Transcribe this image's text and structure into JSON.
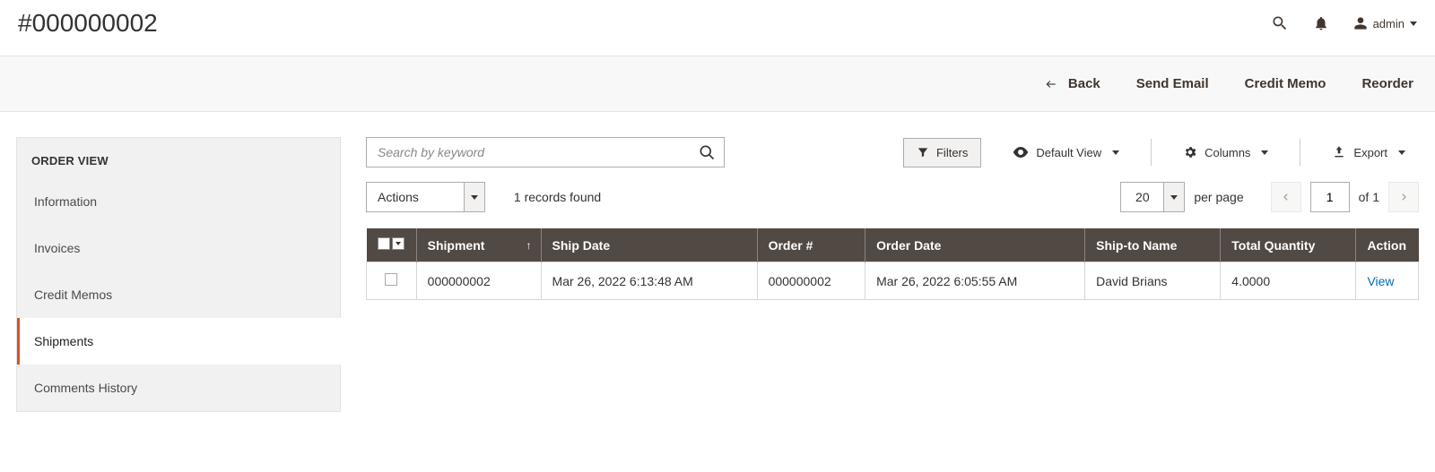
{
  "header": {
    "title": "#000000002",
    "user_label": "admin"
  },
  "action_bar": {
    "back": "Back",
    "send_email": "Send Email",
    "credit_memo": "Credit Memo",
    "reorder": "Reorder"
  },
  "sidebar": {
    "title": "ORDER VIEW",
    "items": [
      {
        "label": "Information",
        "active": false
      },
      {
        "label": "Invoices",
        "active": false
      },
      {
        "label": "Credit Memos",
        "active": false
      },
      {
        "label": "Shipments",
        "active": true
      },
      {
        "label": "Comments History",
        "active": false
      }
    ]
  },
  "toolbar": {
    "search_placeholder": "Search by keyword",
    "filters": "Filters",
    "default_view": "Default View",
    "columns": "Columns",
    "export": "Export",
    "actions_label": "Actions",
    "records_found": "1 records found",
    "page_size": "20",
    "per_page_label": "per page",
    "current_page": "1",
    "total_pages_prefix": "of",
    "total_pages": "1"
  },
  "table": {
    "headers": {
      "shipment": "Shipment",
      "ship_date": "Ship Date",
      "order": "Order #",
      "order_date": "Order Date",
      "ship_to": "Ship-to Name",
      "total_qty": "Total Quantity",
      "action": "Action"
    },
    "rows": [
      {
        "shipment": "000000002",
        "ship_date": "Mar 26, 2022 6:13:48 AM",
        "order": "000000002",
        "order_date": "Mar 26, 2022 6:05:55 AM",
        "ship_to": "David Brians",
        "total_qty": "4.0000",
        "action": "View"
      }
    ]
  }
}
